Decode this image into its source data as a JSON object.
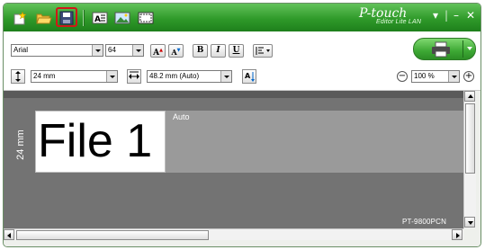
{
  "app": {
    "brand_name": "P-touch",
    "brand_sub": "Editor Lite LAN"
  },
  "title_controls": {
    "menu": "▾",
    "separator": "|",
    "minimize": "–",
    "close": "✕"
  },
  "font": {
    "family": "Arial",
    "size": "64"
  },
  "format_buttons": {
    "grow": "A",
    "shrink": "A",
    "bold": "B",
    "italic": "I",
    "underline": "U"
  },
  "tape": {
    "width": "24 mm",
    "length": "48.2 mm (Auto)"
  },
  "zoom": {
    "minus": "−",
    "value": "100 %",
    "plus": "+"
  },
  "canvas": {
    "label_text": "File 1",
    "tape_width_vertical": "24 mm",
    "length_mode": "Auto",
    "printer_model": "PT-9800PCN"
  },
  "colors": {
    "title_green": "#2f9a2a",
    "highlight_red": "#d01818",
    "canvas_gray": "#737373"
  }
}
